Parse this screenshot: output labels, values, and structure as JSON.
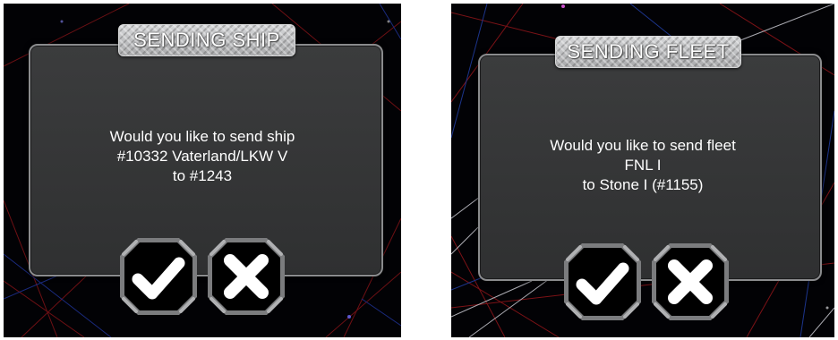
{
  "screens": [
    {
      "id": "send-ship",
      "title": "SENDING SHIP",
      "message_lines": [
        "Would you like to send ship",
        "#10332 Vaterland/LKW V",
        "to #1243"
      ],
      "confirm_icon": "checkmark-icon",
      "cancel_icon": "x-close-icon"
    },
    {
      "id": "send-fleet",
      "title": "SENDING FLEET",
      "message_lines": [
        "Would you like to send fleet",
        "FNL I",
        "to Stone I (#1155)"
      ],
      "confirm_icon": "checkmark-icon",
      "cancel_icon": "x-close-icon"
    }
  ],
  "colors": {
    "background": "#020205",
    "dialog": "#363738",
    "plate": "#bfc0c2",
    "line_red": "#8a1418",
    "line_blue": "#1f3a9a",
    "line_white": "#c8c8d0"
  }
}
